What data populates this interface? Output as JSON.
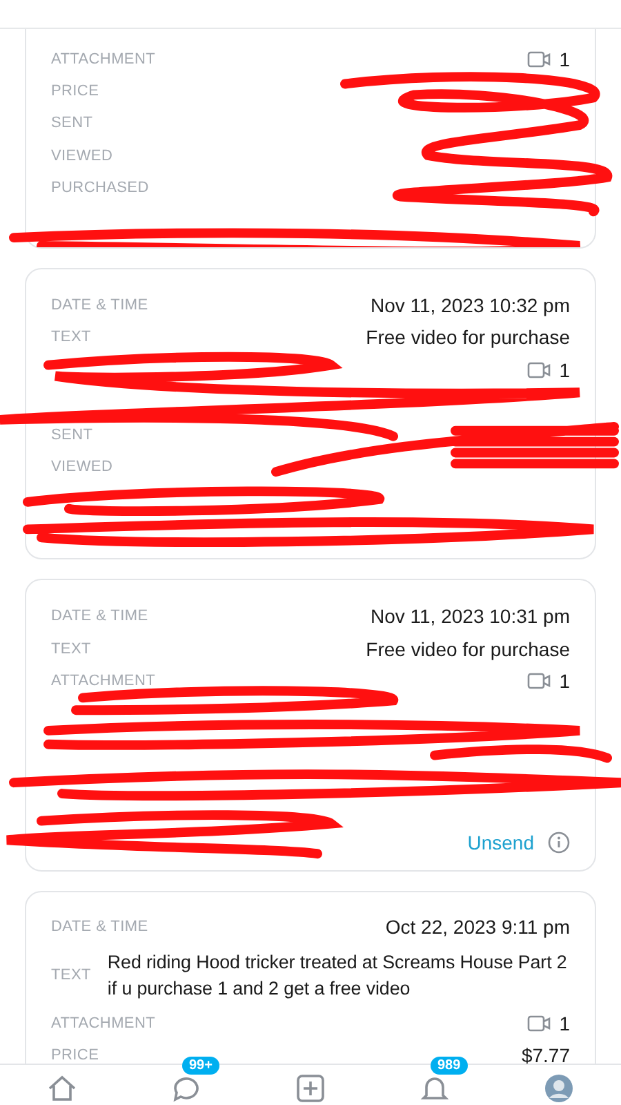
{
  "cards": [
    {
      "cut_top": true,
      "redacted": true,
      "rows": [
        {
          "kind": "attachment",
          "label": "ATTACHMENT",
          "value": "1"
        },
        {
          "kind": "text",
          "label": "PRICE"
        },
        {
          "kind": "text",
          "label": "SENT"
        },
        {
          "kind": "text",
          "label": "VIEWED"
        },
        {
          "kind": "text",
          "label": "PURCHASED"
        },
        {
          "kind": "blank"
        }
      ]
    },
    {
      "cut_top": false,
      "redacted": true,
      "rows": [
        {
          "kind": "text",
          "label": "DATE & TIME",
          "value": "Nov 11, 2023 10:32 pm"
        },
        {
          "kind": "text",
          "label": "TEXT",
          "value": "Free video for purchase"
        },
        {
          "kind": "attachment",
          "value": "1"
        },
        {
          "kind": "blank"
        },
        {
          "kind": "text",
          "label": "SENT"
        },
        {
          "kind": "text",
          "label": "VIEWED"
        },
        {
          "kind": "blank"
        },
        {
          "kind": "blank"
        }
      ]
    },
    {
      "cut_top": false,
      "redacted": true,
      "rows": [
        {
          "kind": "text",
          "label": "DATE & TIME",
          "value": "Nov 11, 2023 10:31 pm"
        },
        {
          "kind": "text",
          "label": "TEXT",
          "value": "Free video for purchase"
        },
        {
          "kind": "attachment",
          "label": "ATTACHMENT",
          "value": "1"
        },
        {
          "kind": "blank"
        },
        {
          "kind": "blank"
        },
        {
          "kind": "blank"
        },
        {
          "kind": "blank"
        },
        {
          "kind": "unsend",
          "value": "Unsend"
        }
      ]
    },
    {
      "cut_top": false,
      "rows": [
        {
          "kind": "text",
          "label": "DATE & TIME",
          "value": "Oct 22, 2023 9:11 pm"
        },
        {
          "kind": "text",
          "label": "TEXT",
          "value": "Red riding Hood tricker treated at Screams House Part 2 if u purchase 1 and 2 get a free video"
        },
        {
          "kind": "attachment",
          "label": "ATTACHMENT",
          "value": "1"
        },
        {
          "kind": "text",
          "label": "PRICE",
          "value": "$7.77"
        }
      ]
    }
  ],
  "nav": [
    {
      "kind": "home"
    },
    {
      "kind": "chat",
      "badge": "99+"
    },
    {
      "kind": "add"
    },
    {
      "kind": "bell",
      "badge": "989"
    },
    {
      "kind": "avatar"
    }
  ]
}
